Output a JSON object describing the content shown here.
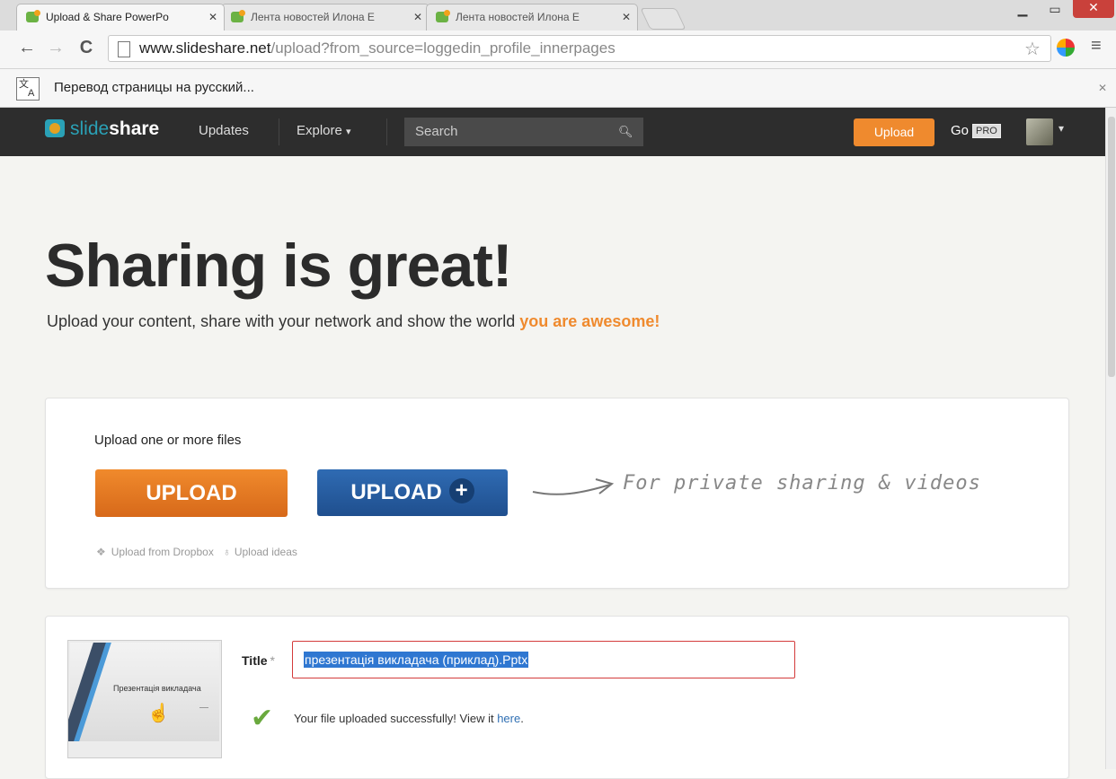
{
  "browser": {
    "tabs": [
      {
        "title": "Upload & Share PowerPo",
        "active": true
      },
      {
        "title": "Лента новостей Илона Е",
        "active": false
      },
      {
        "title": "Лента новостей Илона Е",
        "active": false
      }
    ],
    "url_host": "www.slideshare.net",
    "url_path": "/upload?from_source=loggedin_profile_innerpages",
    "infobar_text": "Перевод страницы на русский...",
    "icons": [
      "back-icon",
      "forward-icon",
      "reload-icon",
      "star-icon",
      "extension-icon",
      "menu-icon",
      "translate-icon",
      "close-icon"
    ]
  },
  "nav": {
    "logo_slide": "slide",
    "logo_share": "share",
    "updates": "Updates",
    "explore": "Explore",
    "explore_caret": "▾",
    "search_placeholder": "Search",
    "upload": "Upload",
    "go": "Go",
    "pro": "PRO"
  },
  "hero": {
    "title": "Sharing is great!",
    "subtitle": "Upload your content, share with your network and show the world ",
    "subtitle_highlight": "you are awesome!"
  },
  "upload_card": {
    "heading": "Upload one or more files",
    "upload_button": "UPLOAD",
    "upload_plus_button": "UPLOAD",
    "private_note": "For private sharing & videos",
    "dropbox_link": "Upload from Dropbox",
    "ideas_link": "Upload ideas"
  },
  "file_card": {
    "thumbnail_text": "Презентація викладача",
    "title_label": "Title",
    "required_mark": "*",
    "title_value": "презентація викладача (приклад).Pptx",
    "success_text": "Your file uploaded successfully! View it ",
    "success_link": "here",
    "success_period": "."
  },
  "colors": {
    "accent_orange": "#ef8a2e",
    "upload_blue": "#2f6bb3",
    "nav_bg": "#2d2d2d",
    "success_green": "#6aa93e"
  }
}
